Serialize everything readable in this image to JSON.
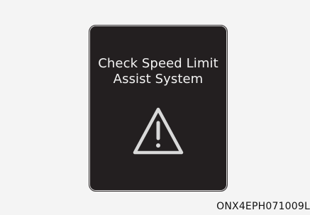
{
  "display": {
    "message_line_1": "Check Speed Limit",
    "message_line_2": "Assist System",
    "icon": "warning-triangle-icon"
  },
  "figure": {
    "code": "ONX4EPH071009L"
  },
  "colors": {
    "background": "#f4f4f4",
    "screen": "#231f20",
    "text": "#f3f3f3",
    "icon": "#d9d9d9"
  }
}
